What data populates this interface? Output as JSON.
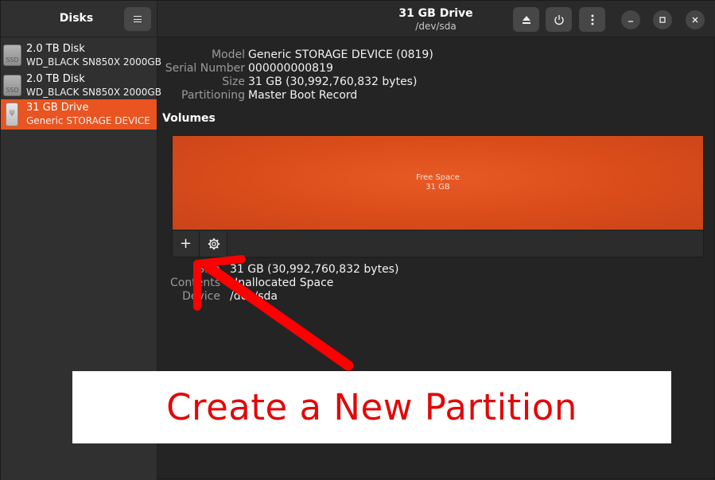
{
  "sidebar": {
    "title": "Disks",
    "items": [
      {
        "name": "2.0 TB Disk",
        "sub": "WD_BLACK SN850X 2000GB",
        "icon_label": "SSD"
      },
      {
        "name": "2.0 TB Disk",
        "sub": "WD_BLACK SN850X 2000GB",
        "icon_label": "SSD"
      },
      {
        "name": "31 GB Drive",
        "sub": "Generic STORAGE DEVICE",
        "icon_label": "ψ"
      }
    ]
  },
  "header": {
    "title": "31 GB Drive",
    "subtitle": "/dev/sda"
  },
  "drive_info": {
    "model_label": "Model",
    "model_value": "Generic STORAGE DEVICE (0819)",
    "serial_label": "Serial Number",
    "serial_value": "000000000819",
    "size_label": "Size",
    "size_value": "31 GB (30,992,760,832 bytes)",
    "partitioning_label": "Partitioning",
    "partitioning_value": "Master Boot Record"
  },
  "volumes": {
    "heading": "Volumes",
    "segment_name": "Free Space",
    "segment_size": "31 GB",
    "add_label": "+",
    "segment_color": "#e95420"
  },
  "partition_info": {
    "size_label": "Size",
    "size_value": "31 GB (30,992,760,832 bytes)",
    "contents_label": "Contents",
    "contents_value": "Unallocated Space",
    "device_label": "Device",
    "device_value": "/dev/sda"
  },
  "callout": {
    "text": "Create a New Partition"
  },
  "colors": {
    "accent": "#e95420",
    "annotation": "#ff0000"
  }
}
